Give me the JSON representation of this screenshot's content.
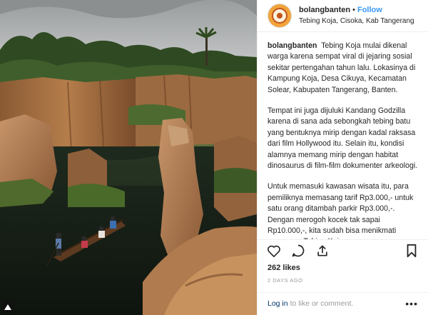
{
  "header": {
    "username": "bolangbanten",
    "separator": "•",
    "follow_label": "Follow",
    "location": "Tebing Koja, Cisoka, Kab Tangerang"
  },
  "caption": {
    "username": "bolangbanten",
    "para1": "Tebing Koja mulai dikenal warga karena sempat viral di jejaring sosial sekitar pertengahan tahun lalu. Lokasinya di Kampung Koja, Desa Cikuya, Kecamatan Solear, Kabupaten Tangerang, Banten.",
    "para2": "Tempat ini juga dijuluki Kandang Godzilla karena di sana ada sebongkah tebing batu yang bentuknya mirip dengan kadal raksasa dari film Hollywood itu. Selain itu, kondisi alamnya memang mirip dengan habitat dinosaurus di film-film dokumenter arkeologi.",
    "para3": "Untuk memasuki kawasan wisata itu, para pemiliknya memasang tarif Rp3.000,- untuk satu orang ditambah parkir Rp3.000,-. Dengan merogoh kocek tak sapai Rp10.000,-, kita sudah bisa menikmati panorama Tebing Koja."
  },
  "likes": "262 likes",
  "time": "2 DAYS AGO",
  "footer": {
    "login_link": "Log in",
    "login_rest": "to like or comment.",
    "more": "•••"
  },
  "icons": {
    "like": "heart-icon",
    "comment": "comment-icon",
    "share": "share-icon",
    "save": "bookmark-icon",
    "corner": "instagram-icon"
  }
}
